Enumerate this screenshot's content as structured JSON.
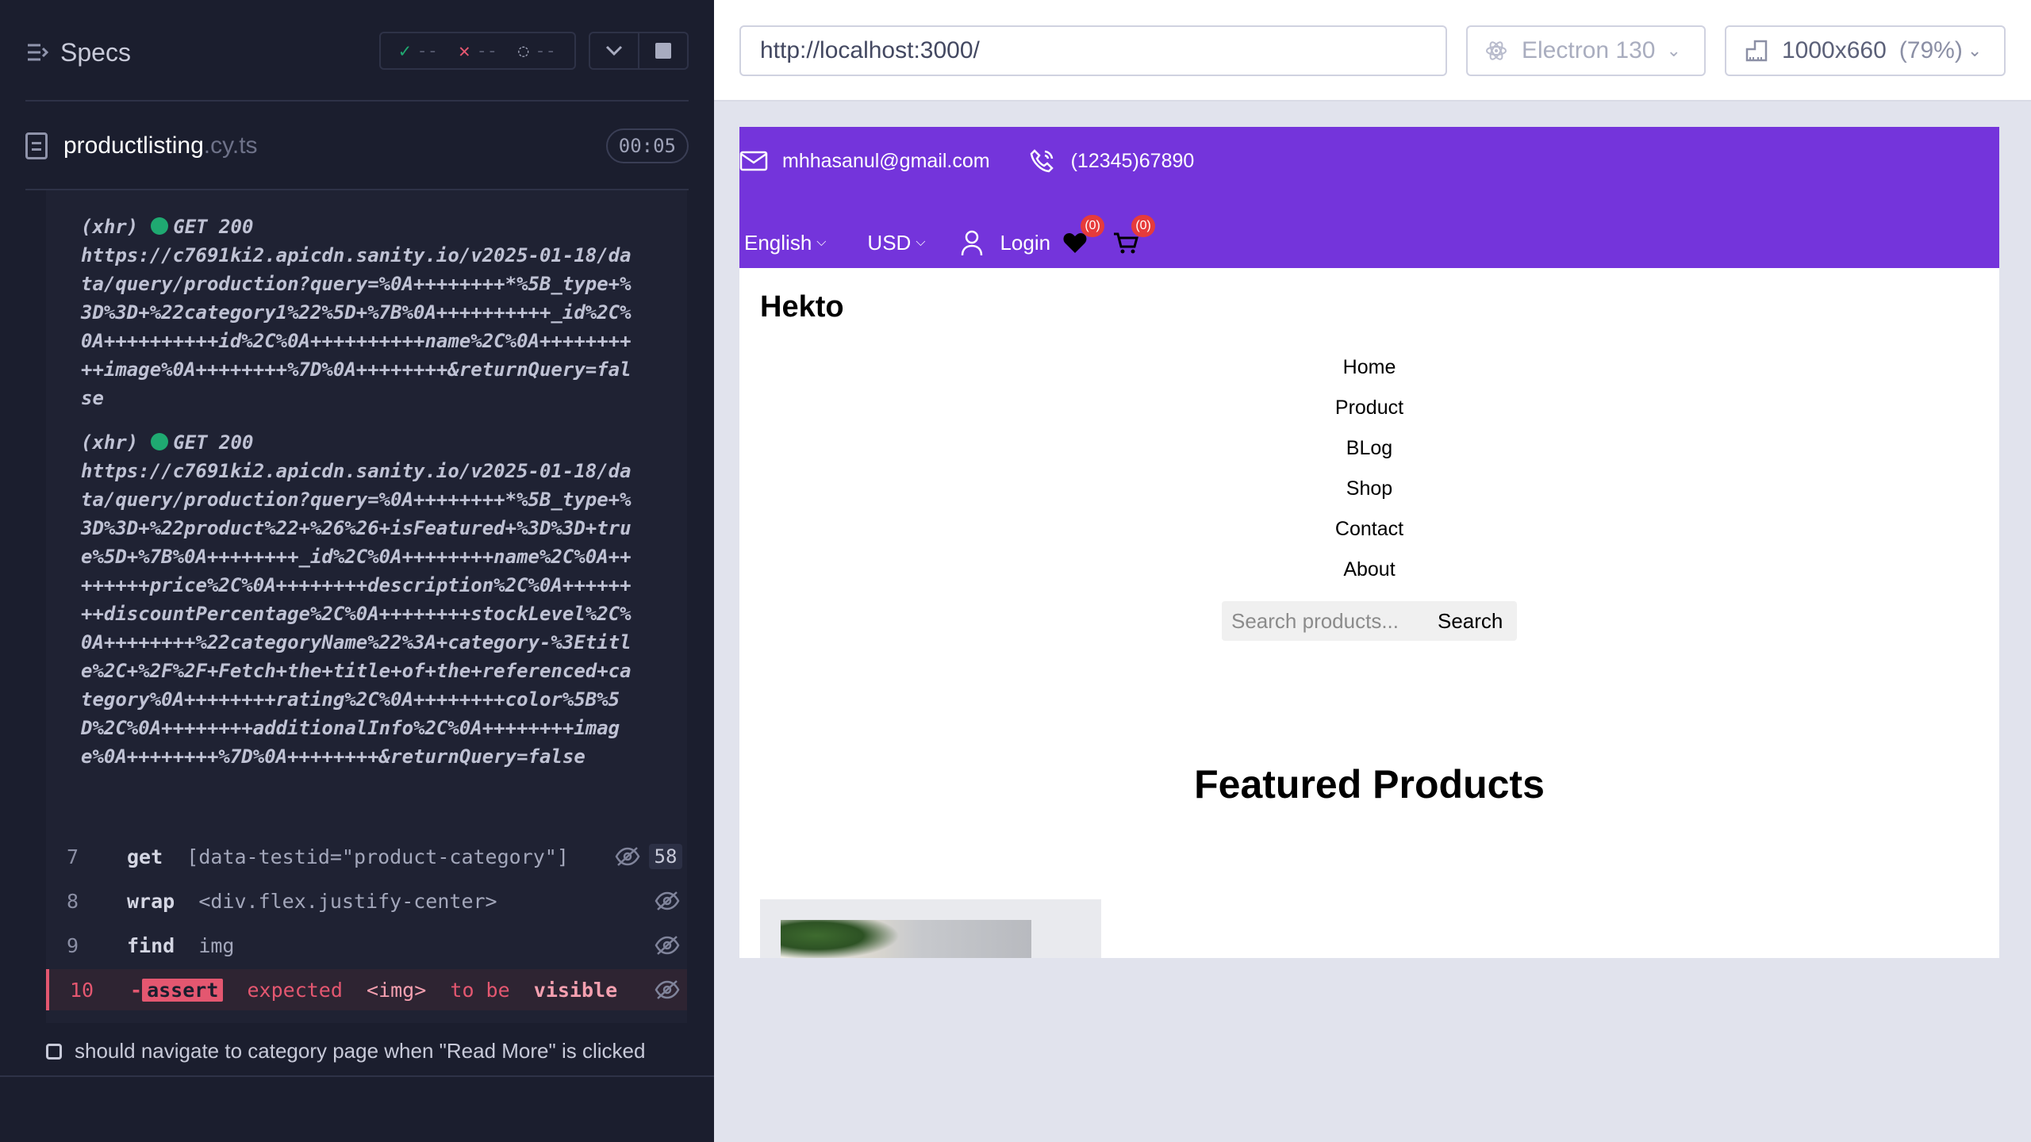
{
  "runner": {
    "specs_label": "Specs",
    "stats": {
      "passed": "--",
      "failed": "--",
      "pending": "--"
    },
    "file": {
      "name": "productlisting",
      "ext": ".cy.ts",
      "duration": "00:05"
    },
    "xhr_logs": [
      {
        "prefix": "(xhr)",
        "status": "GET 200",
        "url": "https://c7691ki2.apicdn.sanity.io/v2025-01-18/data/query/production?query=%0A++++++++*%5B_type+%3D%3D+%22category1%22%5D+%7B%0A++++++++++_id%2C%0A++++++++++id%2C%0A++++++++++name%2C%0A++++++++++image%0A++++++++%7D%0A++++++++&returnQuery=false"
      },
      {
        "prefix": "(xhr)",
        "status": "GET 200",
        "url": "https://c7691ki2.apicdn.sanity.io/v2025-01-18/data/query/production?query=%0A++++++++*%5B_type+%3D%3D+%22product%22+%26%26+isFeatured+%3D%3D+true%5D+%7B%0A++++++++_id%2C%0A++++++++name%2C%0A++++++++price%2C%0A++++++++description%2C%0A++++++++discountPercentage%2C%0A++++++++stockLevel%2C%0A++++++++%22categoryName%22%3A+category-%3Etitle%2C+%2F%2F+Fetch+the+title+of+the+referenced+category%0A++++++++rating%2C%0A++++++++color%5B%5D%2C%0A++++++++additionalInfo%2C%0A++++++++image%0A++++++++%7D%0A++++++++&returnQuery=false"
      }
    ],
    "commands": [
      {
        "num": "7",
        "name": "get",
        "msg": "[data-testid=\"product-category\"]",
        "count": "58"
      },
      {
        "num": "8",
        "name": "wrap",
        "msg": "<div.flex.justify-center>"
      },
      {
        "num": "9",
        "name": "find",
        "msg": "img"
      },
      {
        "num": "10",
        "name": "-",
        "assert_label": "assert",
        "parts": [
          "expected",
          "<img>",
          "to be",
          "visible"
        ]
      }
    ],
    "next_test": "should navigate to category page when \"Read More\" is clicked"
  },
  "browser": {
    "url": "http://localhost:3000/",
    "browser_name": "Electron 130",
    "viewport_size": "1000x660",
    "viewport_scale": "(79%)"
  },
  "site": {
    "email": "mhhasanul@gmail.com",
    "phone": "(12345)67890",
    "language": "English",
    "currency": "USD",
    "login": "Login",
    "wishlist_count": "(0)",
    "cart_count": "(0)",
    "brand": "Hekto",
    "menu": [
      "Home",
      "Product",
      "BLog",
      "Shop",
      "Contact",
      "About"
    ],
    "search_placeholder": "Search products...",
    "search_button": "Search",
    "featured_title": "Featured Products"
  },
  "colors": {
    "runner_bg": "#1b1e2e",
    "pass": "#1fa971",
    "fail": "#e45770",
    "header_purple": "#7434db"
  }
}
